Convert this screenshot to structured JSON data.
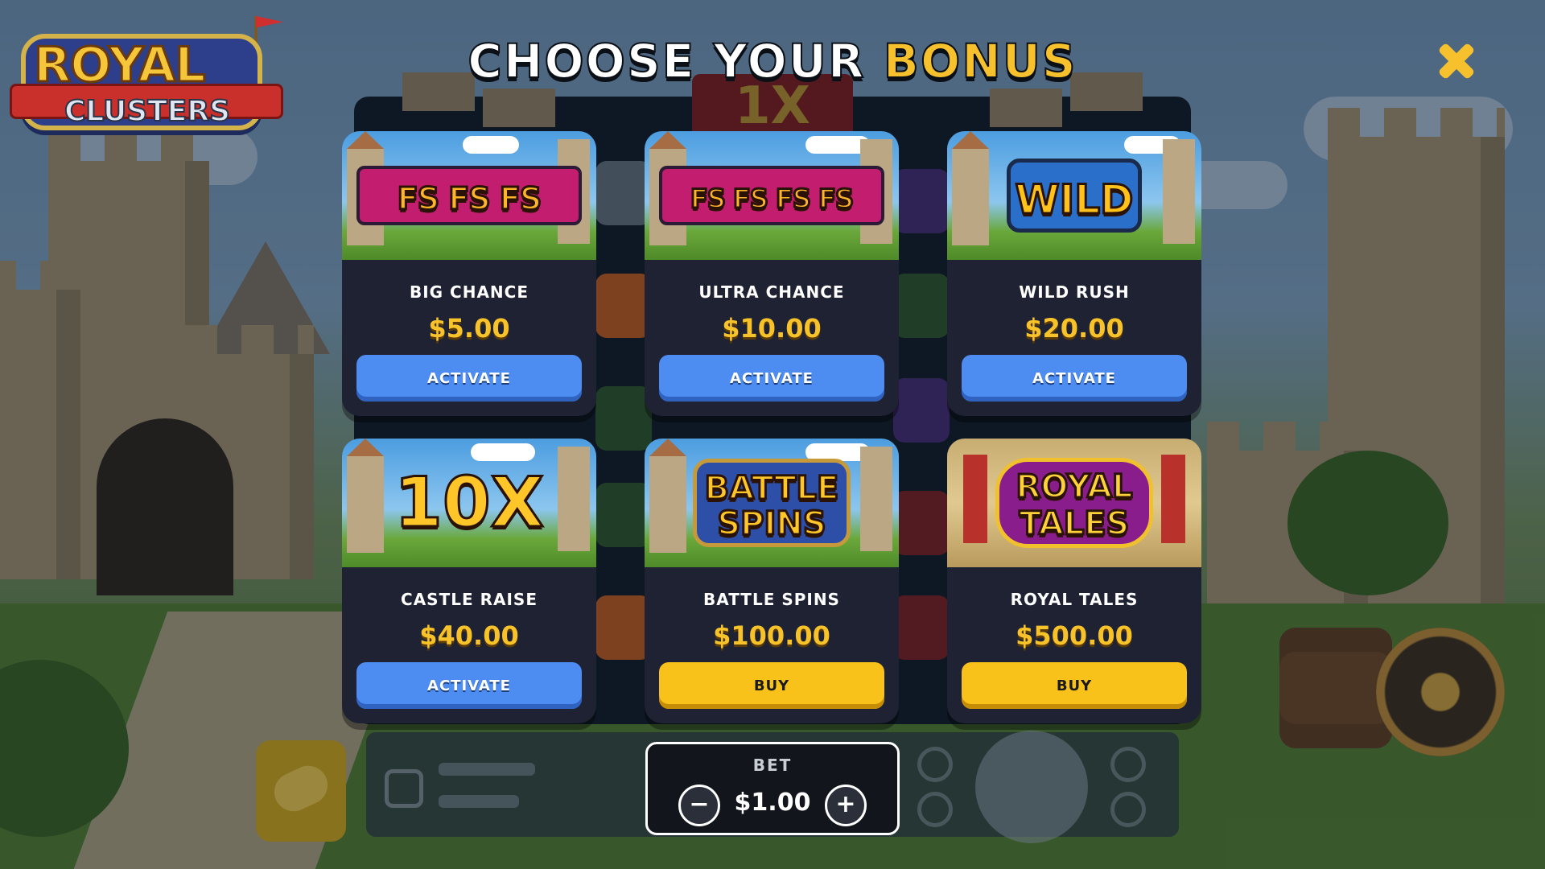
{
  "header": {
    "title_prefix": "CHOOSE YOUR",
    "title_accent": "BONUS"
  },
  "logo": {
    "word1": "ROYAL",
    "word2": "CLUSTERS"
  },
  "background": {
    "multiplier": "1X"
  },
  "bonuses": [
    {
      "art": "FS FS FS",
      "name": "BIG CHANCE",
      "price": "$5.00",
      "button": "ACTIVATE",
      "button_type": "activate"
    },
    {
      "art": "FS FS FS FS",
      "name": "ULTRA CHANCE",
      "price": "$10.00",
      "button": "ACTIVATE",
      "button_type": "activate"
    },
    {
      "art": "WILD",
      "name": "WILD RUSH",
      "price": "$20.00",
      "button": "ACTIVATE",
      "button_type": "activate"
    },
    {
      "art": "10X",
      "name": "CASTLE RAISE",
      "price": "$40.00",
      "button": "ACTIVATE",
      "button_type": "activate"
    },
    {
      "art": "BATTLE SPINS",
      "name": "BATTLE SPINS",
      "price": "$100.00",
      "button": "BUY",
      "button_type": "buy"
    },
    {
      "art": "ROYAL TALES",
      "name": "ROYAL TALES",
      "price": "$500.00",
      "button": "BUY",
      "button_type": "buy"
    }
  ],
  "bet": {
    "label": "BET",
    "value": "$1.00",
    "minus": "−",
    "plus": "+"
  },
  "icons": {
    "close": "close-icon",
    "minus": "minus-icon",
    "plus": "plus-icon"
  },
  "colors": {
    "accent": "#f6c12d",
    "activate": "#4d8df2",
    "buy": "#f9c21a",
    "card_bg": "#1e2232"
  }
}
